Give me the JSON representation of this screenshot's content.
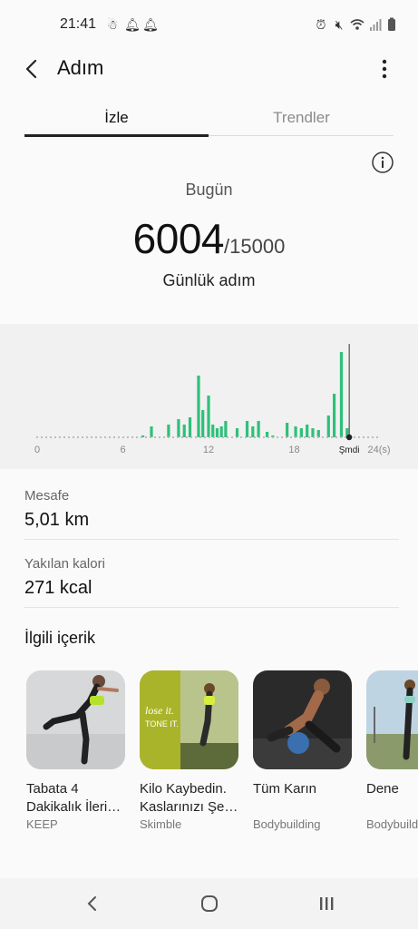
{
  "status_bar": {
    "time": "21:41"
  },
  "header": {
    "title": "Adım"
  },
  "tabs": [
    {
      "label": "İzle"
    },
    {
      "label": "Trendler"
    }
  ],
  "summary": {
    "day": "Bugün",
    "steps": "6004",
    "goal": "/15000",
    "label": "Günlük adım"
  },
  "chart_data": {
    "type": "bar",
    "x_ticks": [
      "0",
      "6",
      "12",
      "18",
      "Şmdi",
      "24(s)"
    ],
    "bars": [
      {
        "x": 7.4,
        "h": 2
      },
      {
        "x": 8.0,
        "h": 12
      },
      {
        "x": 9.2,
        "h": 14
      },
      {
        "x": 9.9,
        "h": 20
      },
      {
        "x": 10.3,
        "h": 14
      },
      {
        "x": 10.7,
        "h": 22
      },
      {
        "x": 11.3,
        "h": 68
      },
      {
        "x": 11.6,
        "h": 30
      },
      {
        "x": 12.0,
        "h": 46
      },
      {
        "x": 12.3,
        "h": 14
      },
      {
        "x": 12.6,
        "h": 10
      },
      {
        "x": 12.9,
        "h": 12
      },
      {
        "x": 13.2,
        "h": 18
      },
      {
        "x": 14.0,
        "h": 10
      },
      {
        "x": 14.7,
        "h": 18
      },
      {
        "x": 15.1,
        "h": 12
      },
      {
        "x": 15.5,
        "h": 18
      },
      {
        "x": 16.1,
        "h": 6
      },
      {
        "x": 16.5,
        "h": 2
      },
      {
        "x": 17.5,
        "h": 16
      },
      {
        "x": 18.1,
        "h": 12
      },
      {
        "x": 18.5,
        "h": 10
      },
      {
        "x": 18.9,
        "h": 14
      },
      {
        "x": 19.3,
        "h": 10
      },
      {
        "x": 19.7,
        "h": 8
      },
      {
        "x": 20.4,
        "h": 24
      },
      {
        "x": 20.8,
        "h": 48
      },
      {
        "x": 21.3,
        "h": 94
      },
      {
        "x": 21.7,
        "h": 10
      }
    ],
    "now_x": 21.85,
    "xlim": [
      0,
      24
    ],
    "bar_color": "#2ec07a"
  },
  "metrics": [
    {
      "label": "Mesafe",
      "value": "5,01 km"
    },
    {
      "label": "Yakılan kalori",
      "value": "271 kcal"
    }
  ],
  "related": {
    "title": "İlgili içerik",
    "cards": [
      {
        "title": "Tabata 4\nDakikalık İleri…",
        "source": "KEEP",
        "icon": "woman-fitness-pose-image"
      },
      {
        "title": "Kilo Kaybedin.\nKaslarınızı Şe…",
        "source": "Skimble",
        "icon": "lose-it-runner-image",
        "image_text": "lose it.\nTONE IT."
      },
      {
        "title": "Tüm Karın",
        "source": "Bodybuilding",
        "icon": "man-medicine-ball-image"
      },
      {
        "title": "Dene",
        "source": "Bodybuildi",
        "icon": "woman-outdoor-image"
      }
    ]
  },
  "colors": {
    "accent": "#2ec07a",
    "tab_active": "#222222"
  }
}
